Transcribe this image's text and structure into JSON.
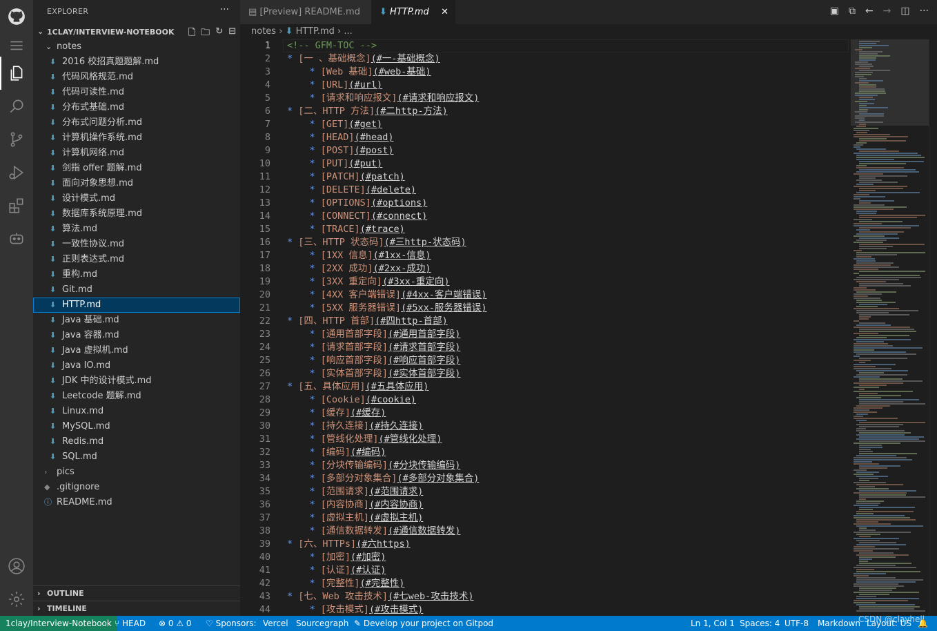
{
  "activity_bar": {
    "items": [
      {
        "icon": "github-icon"
      },
      {
        "icon": "menu-icon"
      },
      {
        "icon": "files-icon"
      },
      {
        "icon": "search-icon"
      },
      {
        "icon": "source-control-icon"
      },
      {
        "icon": "run-debug-icon"
      },
      {
        "icon": "extensions-icon"
      },
      {
        "icon": "remote-icon"
      },
      {
        "icon": "account-icon"
      },
      {
        "icon": "settings-gear-icon"
      }
    ]
  },
  "sidebar": {
    "title": "EXPLORER",
    "more": "···",
    "project": "1CLAY/INTERVIEW-NOTEBOOK",
    "folder": "notes",
    "files": [
      "2016 校招真题题解.md",
      "代码风格规范.md",
      "代码可读性.md",
      "分布式基础.md",
      "分布式问题分析.md",
      "计算机操作系统.md",
      "计算机网络.md",
      "剑指 offer 题解.md",
      "面向对象思想.md",
      "设计模式.md",
      "数据库系统原理.md",
      "算法.md",
      "一致性协议.md",
      "正则表达式.md",
      "重构.md",
      "Git.md",
      "HTTP.md",
      "Java 基础.md",
      "Java 容器.md",
      "Java 虚拟机.md",
      "Java IO.md",
      "JDK 中的设计模式.md",
      "Leetcode 题解.md",
      "Linux.md",
      "MySQL.md",
      "Redis.md",
      "SQL.md"
    ],
    "selected_file": "HTTP.md",
    "other_items": [
      {
        "label": "pics",
        "type": "folder",
        "icon": "chevron-right-icon"
      },
      {
        "label": ".gitignore",
        "type": "file",
        "icon": "gitignore-icon"
      },
      {
        "label": "README.md",
        "type": "file",
        "icon": "info-icon"
      }
    ],
    "outline": "OUTLINE",
    "timeline": "TIMELINE"
  },
  "tabs": [
    {
      "label": "[Preview] README.md",
      "active": false,
      "icon": "preview-icon"
    },
    {
      "label": "HTTP.md",
      "active": true,
      "icon": "markdown-icon",
      "close": "✕"
    }
  ],
  "breadcrumb": {
    "parts": [
      "notes",
      "HTTP.md",
      "..."
    ]
  },
  "editor": {
    "current_line": 1,
    "lines": [
      {
        "n": "1",
        "t": "c",
        "a": "<!-- GFM-TOC -->"
      },
      {
        "n": "2",
        "t": "l",
        "ind": "",
        "a": "[一 、基础概念]",
        "b": "(#一-基础概念)"
      },
      {
        "n": "3",
        "t": "l",
        "ind": "    ",
        "a": "[Web 基础]",
        "b": "(#web-基础)"
      },
      {
        "n": "4",
        "t": "l",
        "ind": "    ",
        "a": "[URL]",
        "b": "(#url)"
      },
      {
        "n": "5",
        "t": "l",
        "ind": "    ",
        "a": "[请求和响应报文]",
        "b": "(#请求和响应报文)"
      },
      {
        "n": "6",
        "t": "l",
        "ind": "",
        "a": "[二、HTTP 方法]",
        "b": "(#二http-方法)"
      },
      {
        "n": "7",
        "t": "l",
        "ind": "    ",
        "a": "[GET]",
        "b": "(#get)"
      },
      {
        "n": "8",
        "t": "l",
        "ind": "    ",
        "a": "[HEAD]",
        "b": "(#head)"
      },
      {
        "n": "9",
        "t": "l",
        "ind": "    ",
        "a": "[POST]",
        "b": "(#post)"
      },
      {
        "n": "10",
        "t": "l",
        "ind": "    ",
        "a": "[PUT]",
        "b": "(#put)"
      },
      {
        "n": "11",
        "t": "l",
        "ind": "    ",
        "a": "[PATCH]",
        "b": "(#patch)"
      },
      {
        "n": "12",
        "t": "l",
        "ind": "    ",
        "a": "[DELETE]",
        "b": "(#delete)"
      },
      {
        "n": "13",
        "t": "l",
        "ind": "    ",
        "a": "[OPTIONS]",
        "b": "(#options)"
      },
      {
        "n": "14",
        "t": "l",
        "ind": "    ",
        "a": "[CONNECT]",
        "b": "(#connect)"
      },
      {
        "n": "15",
        "t": "l",
        "ind": "    ",
        "a": "[TRACE]",
        "b": "(#trace)"
      },
      {
        "n": "16",
        "t": "l",
        "ind": "",
        "a": "[三、HTTP 状态码]",
        "b": "(#三http-状态码)"
      },
      {
        "n": "17",
        "t": "l",
        "ind": "    ",
        "a": "[1XX 信息]",
        "b": "(#1xx-信息)"
      },
      {
        "n": "18",
        "t": "l",
        "ind": "    ",
        "a": "[2XX 成功]",
        "b": "(#2xx-成功)"
      },
      {
        "n": "19",
        "t": "l",
        "ind": "    ",
        "a": "[3XX 重定向]",
        "b": "(#3xx-重定向)"
      },
      {
        "n": "20",
        "t": "l",
        "ind": "    ",
        "a": "[4XX 客户端错误]",
        "b": "(#4xx-客户端错误)"
      },
      {
        "n": "21",
        "t": "l",
        "ind": "    ",
        "a": "[5XX 服务器错误]",
        "b": "(#5xx-服务器错误)"
      },
      {
        "n": "22",
        "t": "l",
        "ind": "",
        "a": "[四、HTTP 首部]",
        "b": "(#四http-首部)"
      },
      {
        "n": "23",
        "t": "l",
        "ind": "    ",
        "a": "[通用首部字段]",
        "b": "(#通用首部字段)"
      },
      {
        "n": "24",
        "t": "l",
        "ind": "    ",
        "a": "[请求首部字段]",
        "b": "(#请求首部字段)"
      },
      {
        "n": "25",
        "t": "l",
        "ind": "    ",
        "a": "[响应首部字段]",
        "b": "(#响应首部字段)"
      },
      {
        "n": "26",
        "t": "l",
        "ind": "    ",
        "a": "[实体首部字段]",
        "b": "(#实体首部字段)"
      },
      {
        "n": "27",
        "t": "l",
        "ind": "",
        "a": "[五、具体应用]",
        "b": "(#五具体应用)"
      },
      {
        "n": "28",
        "t": "l",
        "ind": "    ",
        "a": "[Cookie]",
        "b": "(#cookie)"
      },
      {
        "n": "29",
        "t": "l",
        "ind": "    ",
        "a": "[缓存]",
        "b": "(#缓存)"
      },
      {
        "n": "30",
        "t": "l",
        "ind": "    ",
        "a": "[持久连接]",
        "b": "(#持久连接)"
      },
      {
        "n": "31",
        "t": "l",
        "ind": "    ",
        "a": "[管线化处理]",
        "b": "(#管线化处理)"
      },
      {
        "n": "32",
        "t": "l",
        "ind": "    ",
        "a": "[编码]",
        "b": "(#编码)"
      },
      {
        "n": "33",
        "t": "l",
        "ind": "    ",
        "a": "[分块传输编码]",
        "b": "(#分块传输编码)"
      },
      {
        "n": "34",
        "t": "l",
        "ind": "    ",
        "a": "[多部分对象集合]",
        "b": "(#多部分对象集合)"
      },
      {
        "n": "35",
        "t": "l",
        "ind": "    ",
        "a": "[范围请求]",
        "b": "(#范围请求)"
      },
      {
        "n": "36",
        "t": "l",
        "ind": "    ",
        "a": "[内容协商]",
        "b": "(#内容协商)"
      },
      {
        "n": "37",
        "t": "l",
        "ind": "    ",
        "a": "[虚拟主机]",
        "b": "(#虚拟主机)"
      },
      {
        "n": "38",
        "t": "l",
        "ind": "    ",
        "a": "[通信数据转发]",
        "b": "(#通信数据转发)"
      },
      {
        "n": "39",
        "t": "l",
        "ind": "",
        "a": "[六、HTTPs]",
        "b": "(#六https)"
      },
      {
        "n": "40",
        "t": "l",
        "ind": "    ",
        "a": "[加密]",
        "b": "(#加密)"
      },
      {
        "n": "41",
        "t": "l",
        "ind": "    ",
        "a": "[认证]",
        "b": "(#认证)"
      },
      {
        "n": "42",
        "t": "l",
        "ind": "    ",
        "a": "[完整性]",
        "b": "(#完整性)"
      },
      {
        "n": "43",
        "t": "l",
        "ind": "",
        "a": "[七、Web 攻击技术]",
        "b": "(#七web-攻击技术)"
      },
      {
        "n": "44",
        "t": "l",
        "ind": "    ",
        "a": "[攻击模式]",
        "b": "(#攻击模式)"
      }
    ]
  },
  "status_bar": {
    "remote": "1clay/Interview-Notebook",
    "branch": "HEAD",
    "errors": "0",
    "warnings": "0",
    "sponsors": "Sponsors:",
    "vercel": "Vercel",
    "sourcegraph": "Sourcegraph",
    "gitpod": "Develop your project on Gitpod",
    "position": "Ln 1, Col 1",
    "spaces": "Spaces: 4",
    "encoding": "UTF-8",
    "language": "Markdown",
    "layout": "Layout: US",
    "watermark": "CSDN @clayhell"
  },
  "colors": {
    "activity_bar": "#333333",
    "sidebar": "#252526",
    "editor": "#1e1e1e",
    "status_bar": "#007acc",
    "remote_indicator": "#16825d",
    "selection": "#04395e",
    "markdown_icon": "#519aba",
    "link_text": "#ce9178",
    "comment": "#6a9955"
  }
}
